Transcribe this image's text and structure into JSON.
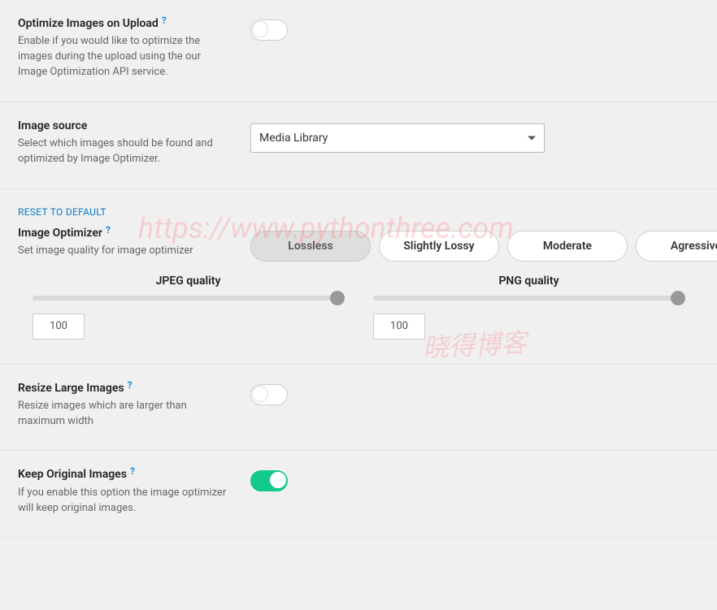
{
  "watermark": {
    "url": "https://www.pythonthree.com",
    "cn": "晓得博客"
  },
  "optimize_on_upload": {
    "title": "Optimize Images on Upload",
    "desc": "Enable if you would like to optimize the images during the upload using the our Image Optimization API service.",
    "enabled": false
  },
  "image_source": {
    "title": "Image source",
    "desc": "Select which images should be found and optimized by Image Optimizer.",
    "selected": "Media Library"
  },
  "optimizer": {
    "reset": "RESET TO DEFAULT",
    "title": "Image Optimizer",
    "desc": "Set image quality for image optimizer",
    "options": [
      "Lossless",
      "Slightly Lossy",
      "Moderate",
      "Agressive"
    ],
    "selected_index": 0
  },
  "quality": {
    "jpeg": {
      "label": "JPEG quality",
      "value": "100"
    },
    "png": {
      "label": "PNG quality",
      "value": "100"
    }
  },
  "resize_large": {
    "title": "Resize Large Images",
    "desc": "Resize images which are larger than maximum width",
    "enabled": false
  },
  "keep_original": {
    "title": "Keep Original Images",
    "desc": "If you enable this option the image optimizer will keep original images.",
    "enabled": true
  }
}
